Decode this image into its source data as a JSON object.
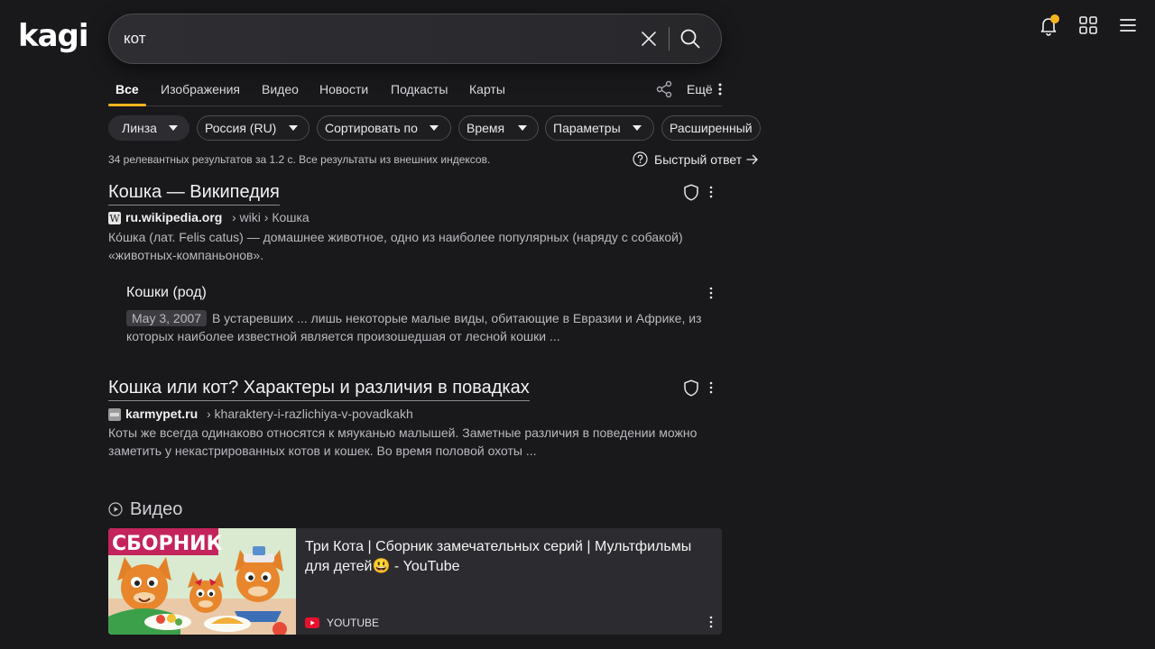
{
  "brand": {
    "logo_text": "kagi"
  },
  "search": {
    "query": "кот"
  },
  "tabs": {
    "items": [
      {
        "label": "Все"
      },
      {
        "label": "Изображения"
      },
      {
        "label": "Видео"
      },
      {
        "label": "Новости"
      },
      {
        "label": "Подкасты"
      },
      {
        "label": "Карты"
      }
    ],
    "more_label": "Ещё"
  },
  "filters": [
    {
      "label": "Линза"
    },
    {
      "label": "Россия (RU)"
    },
    {
      "label": "Сортировать по"
    },
    {
      "label": "Время"
    },
    {
      "label": "Параметры"
    },
    {
      "label": "Расширенный"
    }
  ],
  "stats": {
    "text": "34 релевантных результатов за 1.2 с. Все результаты из внешних индексов.",
    "quick_answer_label": "Быстрый ответ"
  },
  "results": [
    {
      "title": "Кошка — Википедия",
      "domain": "ru.wikipedia.org",
      "path": "› wiki › Кошка",
      "snippet": "Ко́шка (лат. Felis catus) — домашнее животное, одно из наиболее популярных (наряду с собакой) «животных-компаньонов».",
      "subresult": {
        "title": "Кошки (род)",
        "date": "May 3, 2007",
        "snippet": "В устаревших ... лишь некоторые малые виды, обитающие в Евразии и Африке, из которых наиболее известной является произошедшая от лесной кошки ..."
      }
    },
    {
      "title": "Кошка или кот? Характеры и различия в повадках",
      "domain": "karmypet.ru",
      "path": "› kharaktery-i-razlichiya-v-povadkakh",
      "snippet": "Коты же всегда одинаково относятся к мяуканью малышей. Заметные различия в поведении можно заметить у некастрированных котов и кошек. Во время половой охоты ..."
    }
  ],
  "videos": {
    "heading": "Видео",
    "items": [
      {
        "title": "Три Кота | Сборник замечательных серий | Мультфильмы для детей😃 - YouTube",
        "source": "YOUTUBE",
        "thumb_text": "СБОРНИК"
      }
    ]
  },
  "colors": {
    "accent": "#f6b61e",
    "background": "#19191c",
    "youtube_red": "#e8112d"
  }
}
